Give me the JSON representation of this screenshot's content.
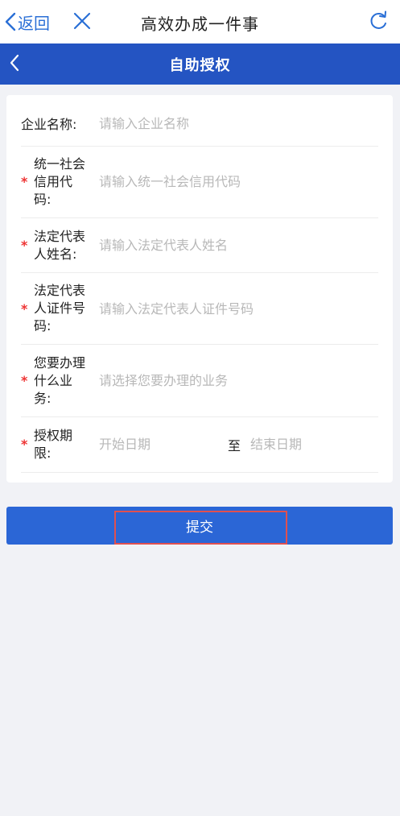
{
  "topbar": {
    "back_label": "返回",
    "title": "高效办成一件事"
  },
  "navbar": {
    "title": "自助授权"
  },
  "form": {
    "company_name": {
      "label": "企业名称:",
      "placeholder": "请输入企业名称",
      "required": false
    },
    "credit_code": {
      "label_lines": [
        "统一社会",
        "信用代",
        "码:"
      ],
      "placeholder": "请输入统一社会信用代码",
      "required": true
    },
    "legal_rep_name": {
      "label_lines": [
        "法定代表",
        "人姓名:"
      ],
      "placeholder": "请输入法定代表人姓名",
      "required": true
    },
    "legal_rep_id": {
      "label_lines": [
        "法定代表",
        "人证件号",
        "码:"
      ],
      "placeholder": "请输入法定代表人证件号码",
      "required": true
    },
    "business": {
      "label_lines": [
        "您要办理",
        "什么业",
        "务:"
      ],
      "placeholder": "请选择您要办理的业务",
      "required": true
    },
    "auth_period": {
      "label_lines": [
        "授权期",
        "限:"
      ],
      "start_placeholder": "开始日期",
      "separator": "至",
      "end_placeholder": "结束日期",
      "required": true
    },
    "required_mark": "*"
  },
  "submit_label": "提交",
  "colors": {
    "accent": "#2454c2",
    "button": "#2b66d6",
    "required": "#e33333",
    "highlight": "#e05050"
  },
  "icons": {
    "back": "chevron-left-icon",
    "close": "close-icon",
    "refresh": "refresh-icon",
    "nav_back": "chevron-left-icon"
  }
}
